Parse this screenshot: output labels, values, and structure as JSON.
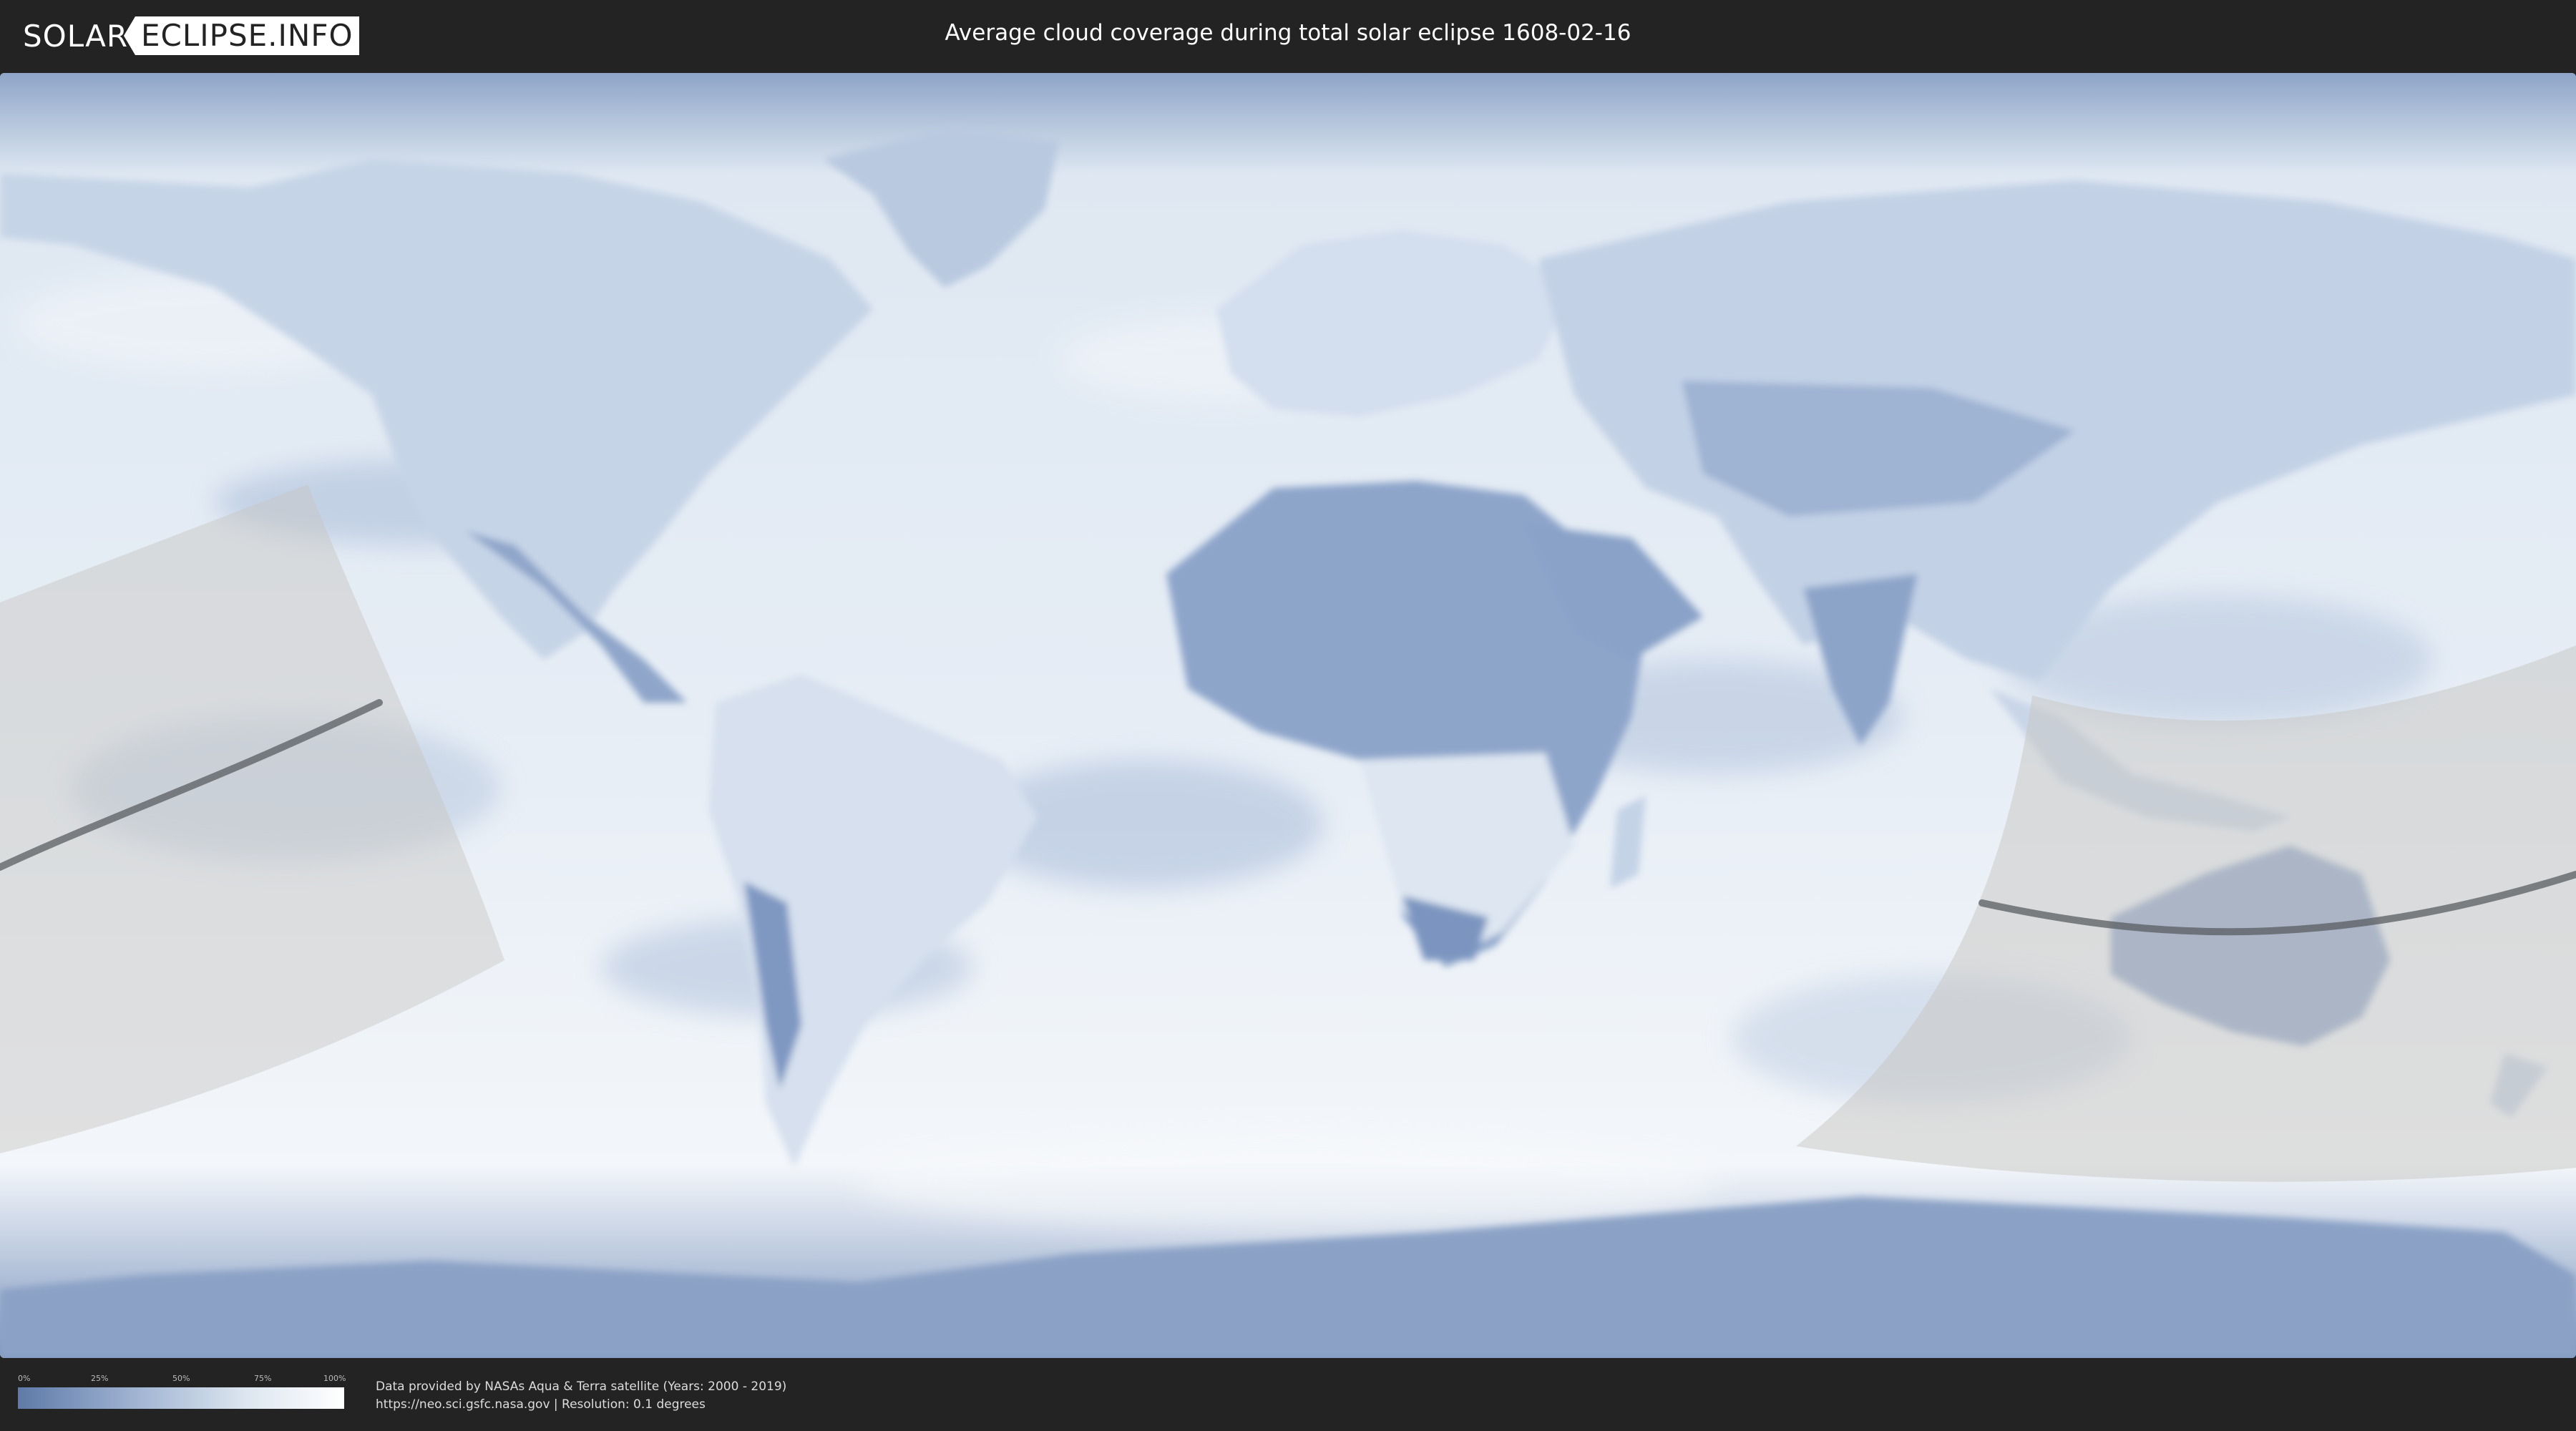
{
  "header": {
    "logo_left": "SOLAR",
    "logo_right": "ECLIPSE.INFO",
    "title": "Average cloud coverage during total solar eclipse 1608-02-16"
  },
  "map": {
    "colors": {
      "clear_sky": "#5f7aa8",
      "full_cloud": "#ffffff",
      "eclipse_zone": "#c8c6c2",
      "central_line": "#5a5d62"
    }
  },
  "legend": {
    "ticks": [
      "0%",
      "25%",
      "50%",
      "75%",
      "100%"
    ]
  },
  "footer": {
    "credit_line1": "Data provided by NASAs Aqua & Terra satellite (Years: 2000 - 2019)",
    "credit_line2": "https://neo.sci.gsfc.nasa.gov | Resolution: 0.1 degrees"
  }
}
